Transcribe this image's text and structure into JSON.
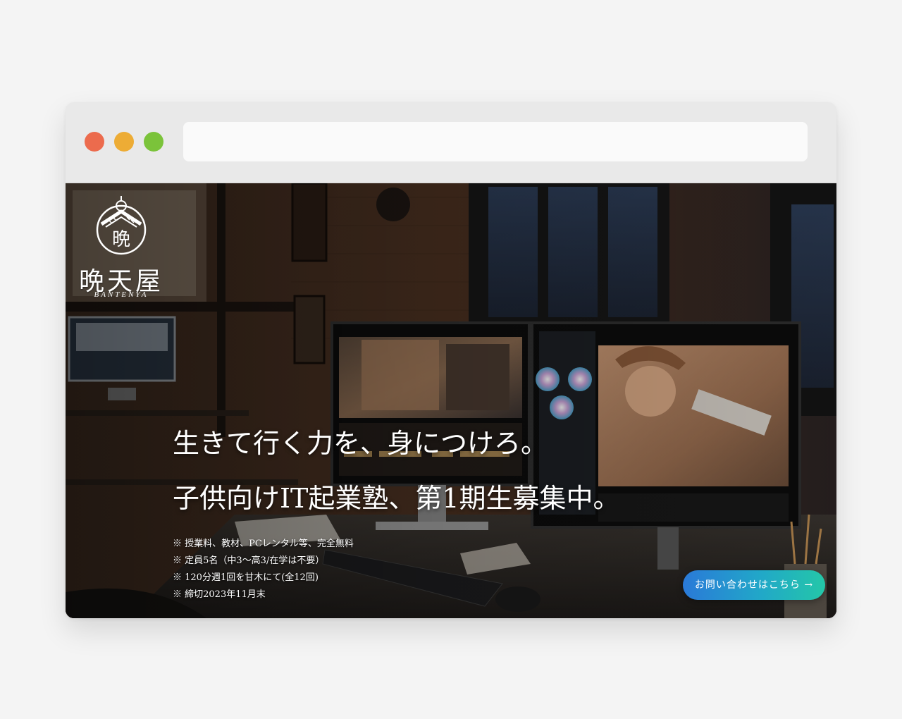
{
  "browser": {
    "address_value": ""
  },
  "hero": {
    "logo_kanji": "晩天屋",
    "logo_roman": "BANTENYA",
    "logo_emblem_char": "晩",
    "headline_line1": "生きて行く力を、身につけろ。",
    "headline_line2": "子供向けIT起業塾、第1期生募集中。",
    "notes": [
      "※ 授業料、教材、PCレンタル等、完全無料",
      "※ 定員5名（中3〜高3/在学は不要）",
      "※ 120分週1回を甘木にて(全12回)",
      "※ 締切2023年11月末"
    ],
    "cta_label": "お問い合わせはこちら →"
  },
  "colors": {
    "dot_red": "#ec6b4d",
    "dot_yellow": "#edac35",
    "dot_green": "#7bc33a",
    "cta_gradient_start": "#2a79d8",
    "cta_gradient_end": "#24c7a8"
  }
}
